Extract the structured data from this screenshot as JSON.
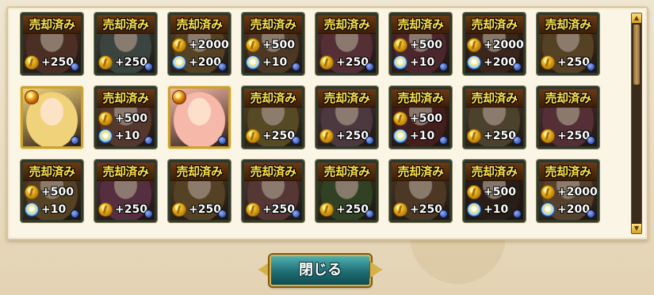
{
  "sold_label": "売却済み",
  "close_button": {
    "label": "閉じる"
  },
  "cards": [
    {
      "sold": true,
      "rewards": [
        {
          "icon": "coin-icon",
          "text": "+250"
        }
      ],
      "tint": "#7a4a3a"
    },
    {
      "sold": true,
      "rewards": [
        {
          "icon": "coin-icon",
          "text": "+250"
        }
      ],
      "tint": "#5e6f6a"
    },
    {
      "sold": true,
      "rewards": [
        {
          "icon": "coin-icon",
          "text": "+2000"
        },
        {
          "icon": "gem-icon",
          "text": "+200"
        }
      ],
      "tint": "#8a6a3a"
    },
    {
      "sold": true,
      "rewards": [
        {
          "icon": "coin-icon",
          "text": "+500"
        },
        {
          "icon": "gem-icon",
          "text": "+10"
        }
      ],
      "tint": "#7a5a3a"
    },
    {
      "sold": true,
      "rewards": [
        {
          "icon": "coin-icon",
          "text": "+250"
        }
      ],
      "tint": "#8a4a5a"
    },
    {
      "sold": true,
      "rewards": [
        {
          "icon": "coin-icon",
          "text": "+500"
        },
        {
          "icon": "gem-icon",
          "text": "+10"
        }
      ],
      "tint": "#7a3a4a"
    },
    {
      "sold": true,
      "rewards": [
        {
          "icon": "coin-icon",
          "text": "+2000"
        },
        {
          "icon": "gem-icon",
          "text": "+200"
        }
      ],
      "tint": "#5a3a2a"
    },
    {
      "sold": true,
      "rewards": [
        {
          "icon": "coin-icon",
          "text": "+250"
        }
      ],
      "tint": "#8a6a3a"
    },
    {
      "sold": false,
      "rewards": [],
      "tint": "#f0d27a",
      "featured": true
    },
    {
      "sold": true,
      "rewards": [
        {
          "icon": "coin-icon",
          "text": "+500"
        },
        {
          "icon": "gem-icon",
          "text": "+10"
        }
      ],
      "tint": "#8a5a4a"
    },
    {
      "sold": false,
      "rewards": [],
      "tint": "#f6b8a8",
      "featured": true
    },
    {
      "sold": true,
      "rewards": [
        {
          "icon": "coin-icon",
          "text": "+250"
        }
      ],
      "tint": "#8a7a3a"
    },
    {
      "sold": true,
      "rewards": [
        {
          "icon": "coin-icon",
          "text": "+250"
        }
      ],
      "tint": "#7a5a6a"
    },
    {
      "sold": true,
      "rewards": [
        {
          "icon": "coin-icon",
          "text": "+500"
        },
        {
          "icon": "gem-icon",
          "text": "+10"
        }
      ],
      "tint": "#6a2a2a"
    },
    {
      "sold": true,
      "rewards": [
        {
          "icon": "coin-icon",
          "text": "+250"
        }
      ],
      "tint": "#7a6a4a"
    },
    {
      "sold": true,
      "rewards": [
        {
          "icon": "coin-icon",
          "text": "+250"
        }
      ],
      "tint": "#8a4a5a"
    },
    {
      "sold": true,
      "rewards": [
        {
          "icon": "coin-icon",
          "text": "+500"
        },
        {
          "icon": "gem-icon",
          "text": "+10"
        }
      ],
      "tint": "#8a6a3a"
    },
    {
      "sold": true,
      "rewards": [
        {
          "icon": "coin-icon",
          "text": "+250"
        }
      ],
      "tint": "#8a4a6a"
    },
    {
      "sold": true,
      "rewards": [
        {
          "icon": "coin-icon",
          "text": "+250"
        }
      ],
      "tint": "#8a6a3a"
    },
    {
      "sold": true,
      "rewards": [
        {
          "icon": "coin-icon",
          "text": "+250"
        }
      ],
      "tint": "#8a5a5a"
    },
    {
      "sold": true,
      "rewards": [
        {
          "icon": "coin-icon",
          "text": "+250"
        }
      ],
      "tint": "#4a6a3a"
    },
    {
      "sold": true,
      "rewards": [
        {
          "icon": "coin-icon",
          "text": "+250"
        }
      ],
      "tint": "#7a5a3a"
    },
    {
      "sold": true,
      "rewards": [
        {
          "icon": "coin-icon",
          "text": "+500"
        },
        {
          "icon": "gem-icon",
          "text": "+10"
        }
      ],
      "tint": "#3a2a22"
    },
    {
      "sold": true,
      "rewards": [
        {
          "icon": "coin-icon",
          "text": "+2000"
        },
        {
          "icon": "gem-icon",
          "text": "+200"
        }
      ],
      "tint": "#8a6a4a"
    }
  ]
}
